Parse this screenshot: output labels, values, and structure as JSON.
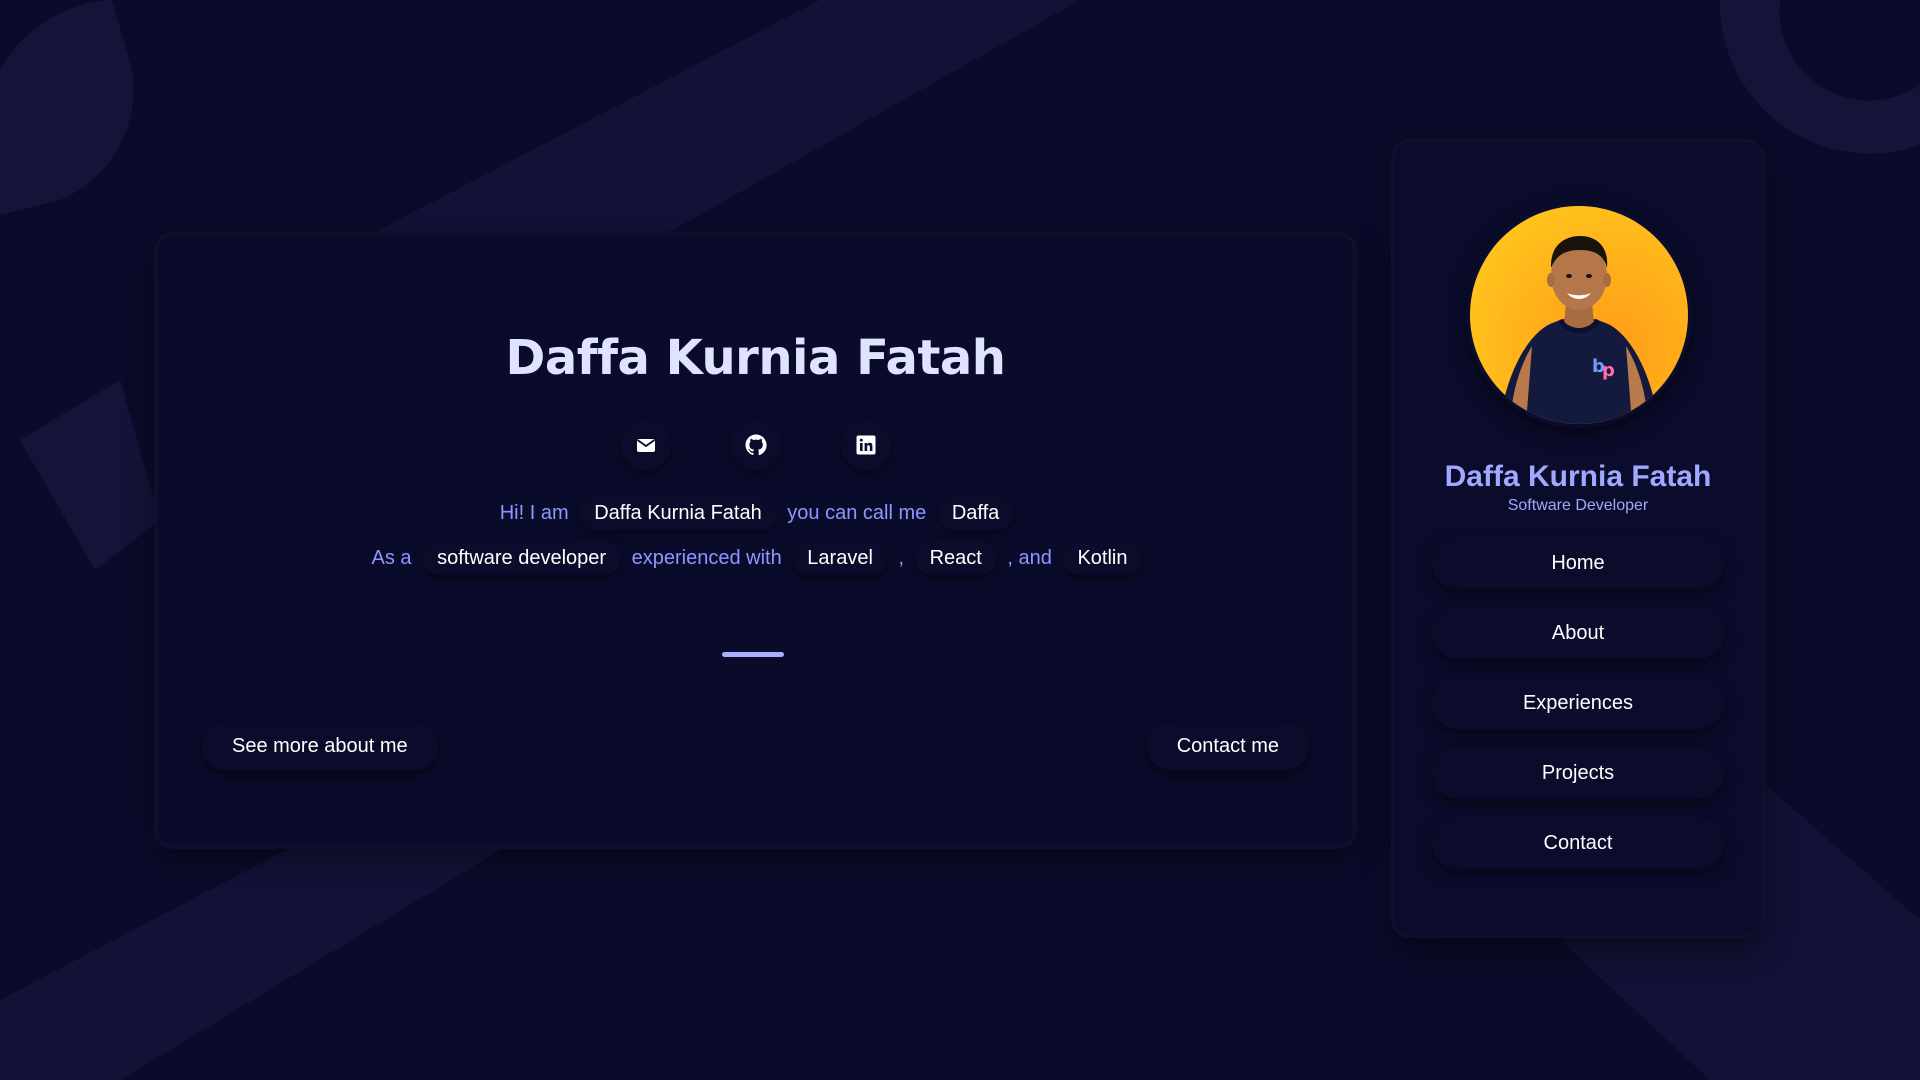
{
  "hero": {
    "title": "Daffa Kurnia Fatah",
    "socials": [
      {
        "icon": "mail-icon",
        "label": "Email"
      },
      {
        "icon": "github-icon",
        "label": "GitHub"
      },
      {
        "icon": "linkedin-icon",
        "label": "LinkedIn"
      }
    ],
    "intro_line1": {
      "prefix": "Hi! I am",
      "name": "Daffa Kurnia Fatah",
      "middle": "you can call me",
      "nickname": "Daffa"
    },
    "intro_line2": {
      "prefix": "As a",
      "role": "software developer",
      "middle": "experienced with",
      "skill1": "Laravel",
      "sep1": ",",
      "skill2": "React",
      "sep2": ", and",
      "skill3": "Kotlin"
    },
    "see_more_label": "See more about me",
    "contact_label": "Contact me"
  },
  "sidebar": {
    "name": "Daffa Kurnia Fatah",
    "role": "Software Developer",
    "nav": [
      "Home",
      "About",
      "Experiences",
      "Projects",
      "Contact"
    ]
  },
  "colors": {
    "background": "#0a0b2a",
    "accent": "#a0a8ff",
    "avatar_bg": "#ffb21a"
  }
}
